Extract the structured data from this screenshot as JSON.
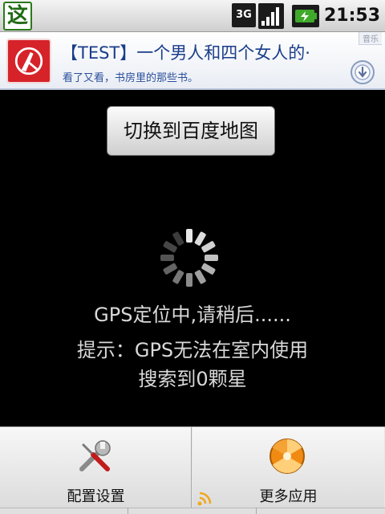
{
  "status_bar": {
    "app_glyph": "这",
    "network": "3G",
    "time": "21:53"
  },
  "ad": {
    "title": "【TEST】一个男人和四个女人的·",
    "subtitle": "看了又看，书房里的那些书。",
    "corner_tag": "音乐",
    "accent_color": "#d6232a"
  },
  "main": {
    "switch_button_label": "切换到百度地图",
    "status_lines": [
      "GPS定位中,请稍后......",
      "提示：GPS无法在室内使用",
      "搜索到0颗星"
    ]
  },
  "menu": {
    "items": [
      {
        "label": "配置设置",
        "icon": "wrench-screwdriver-icon"
      },
      {
        "label": "更多应用",
        "icon": "orange-ball-icon"
      }
    ]
  }
}
